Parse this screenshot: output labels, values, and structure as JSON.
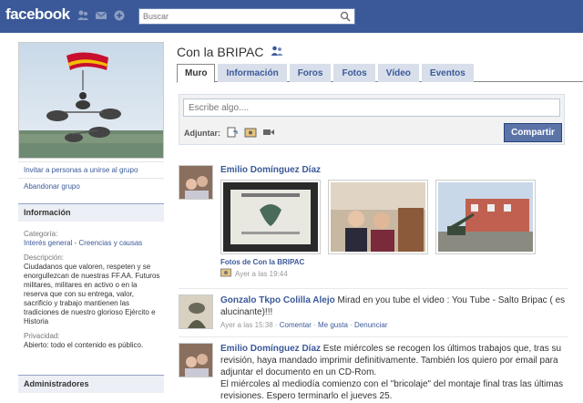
{
  "header": {
    "logo": "facebook",
    "search_placeholder": "Buscar"
  },
  "group": {
    "name": "Con la BRIPAC"
  },
  "sidebar": {
    "links": [
      "Invitar a personas a unirse al grupo",
      "Abandonar grupo"
    ],
    "info_title": "Información",
    "categoria_label": "Categoría:",
    "categoria_value": "Interés general - Creencias y causas",
    "descripcion_label": "Descripción:",
    "descripcion_value": "Ciudadanos que valoren, respeten y se enorgullezcan de nuestras FF.AA. Futuros militares, militares en activo o en la reserva que con su entrega, valor, sacrificio y trabajo mantienen las tradiciones de nuestro glorioso Ejército e Historia",
    "privacidad_label": "Privacidad:",
    "privacidad_value": "Abierto: todo el contenido es público.",
    "admins_title": "Administradores"
  },
  "tabs": [
    "Muro",
    "Información",
    "Foros",
    "Fotos",
    "Vídeo",
    "Eventos"
  ],
  "composer": {
    "placeholder": "Escribe algo....",
    "attach_label": "Adjuntar:",
    "share_label": "Compartir"
  },
  "posts": [
    {
      "author": "Emilio Domínguez Díaz",
      "album": "Fotos de Con la BRIPAC",
      "time": "Ayer a las 19:44"
    },
    {
      "author": "Gonzalo Tkpo Colilla Alejo",
      "text": "Mirad en you tube el video : You Tube - Salto Bripac ( es alucinante)!!!",
      "time": "Ayer a las 15:38",
      "comment": "Comentar",
      "like": "Me gusta",
      "report": "Denunciar"
    },
    {
      "author": "Emilio Domínguez Díaz",
      "text": "Este miércoles se recogen los últimos trabajos que, tras su revisión, haya mandado imprimir definitivamente. También los quiero por email para adjuntar el documento en un CD-Rom.",
      "text2": "El miércoles al mediodía comienzo con el \"bricolaje\" del montaje final tras las últimas revisiones. Espero terminarlo el jueves 25."
    }
  ],
  "colors": {
    "brand": "#3b5998",
    "tab_bg": "#d8dfea",
    "button": "#5b74a8"
  }
}
